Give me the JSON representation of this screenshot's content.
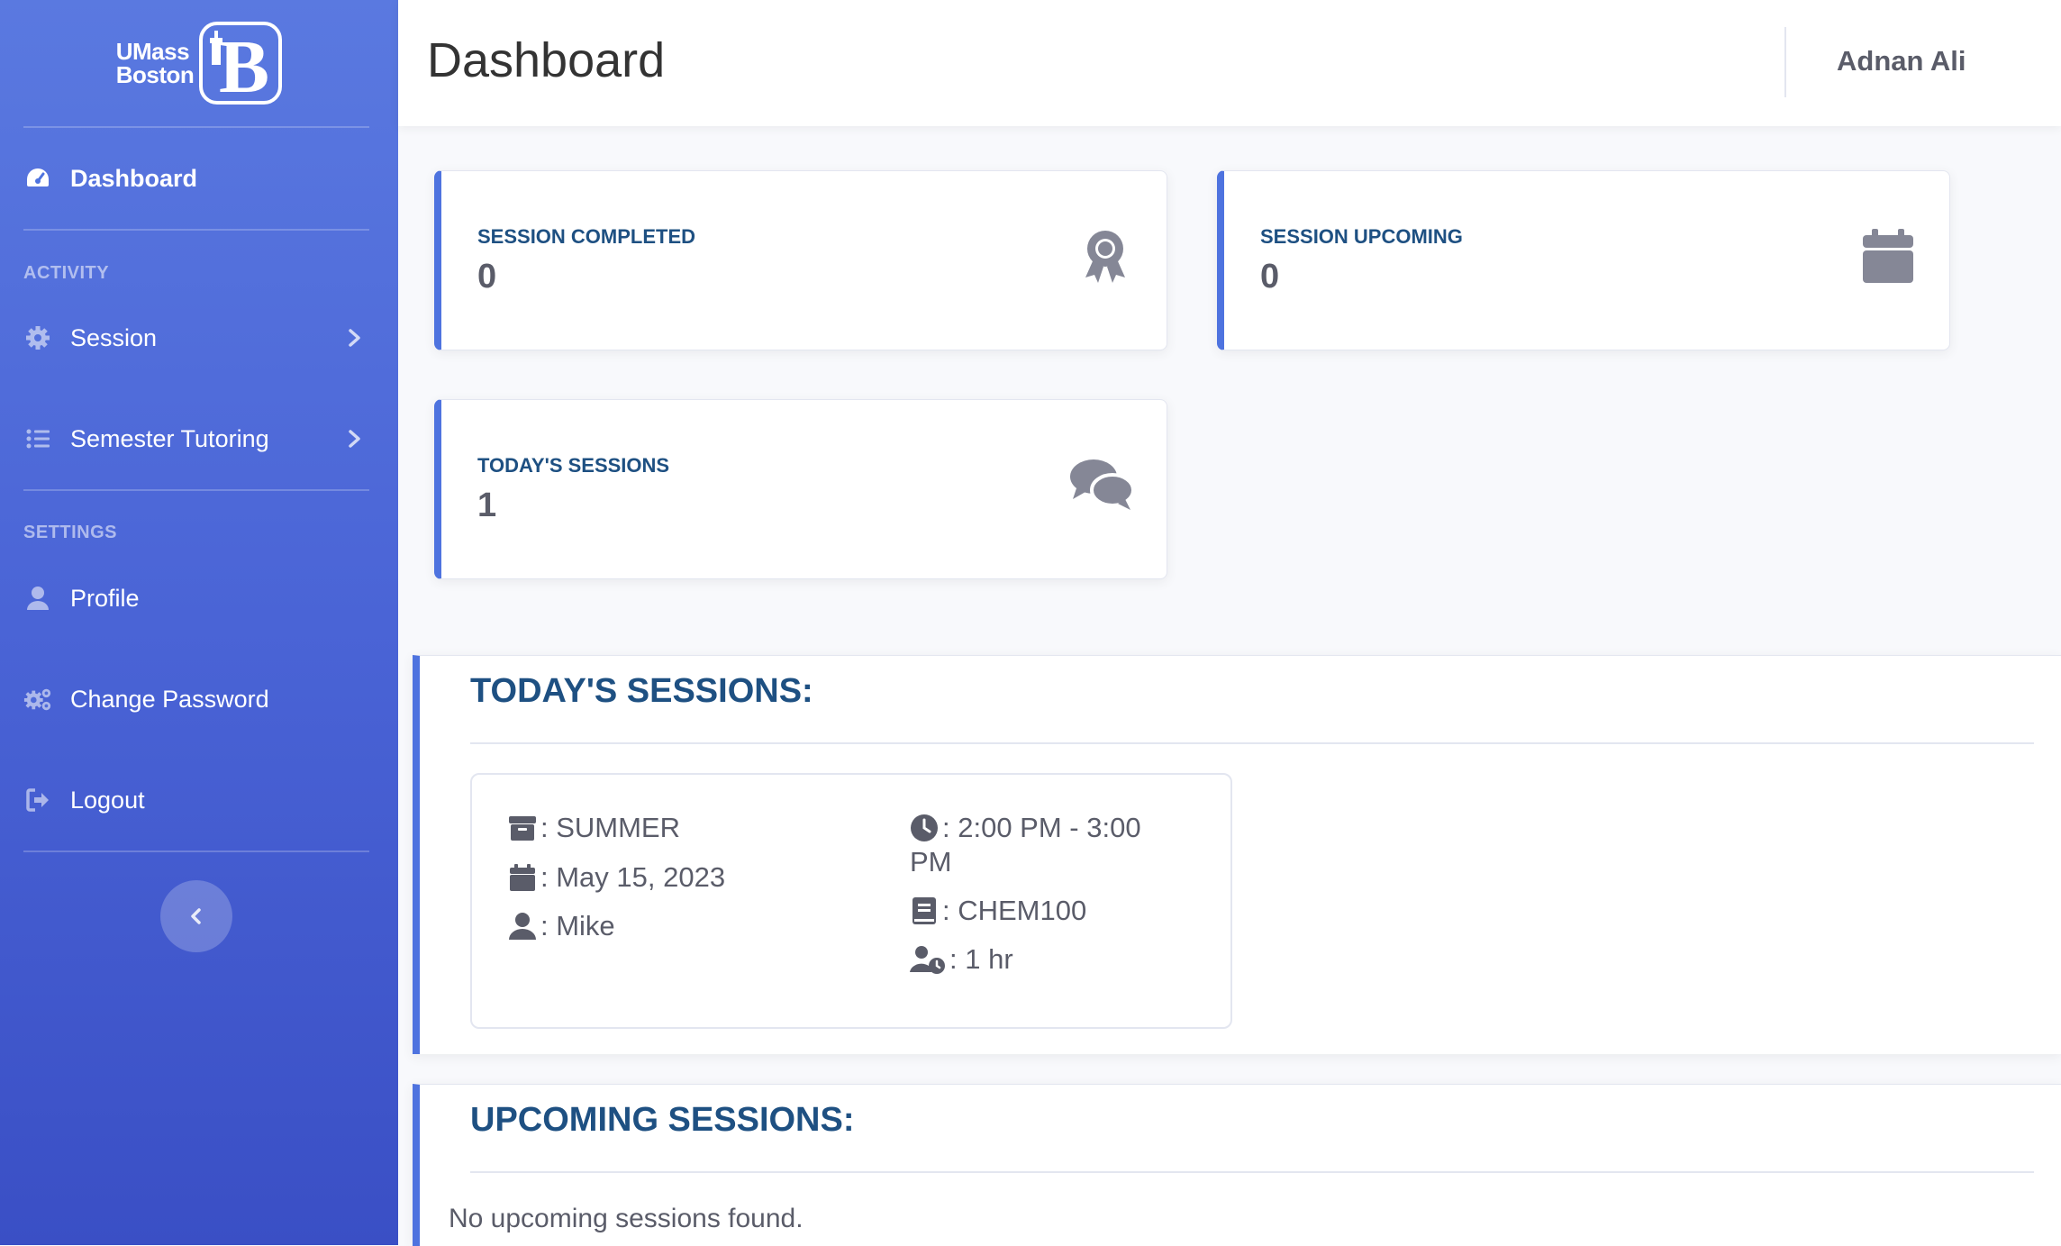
{
  "brand": {
    "line1": "UMass",
    "line2": "Boston"
  },
  "sidebar": {
    "dashboard": "Dashboard",
    "heading_activity": "ACTIVITY",
    "session": "Session",
    "semester_tutoring": "Semester Tutoring",
    "heading_settings": "SETTINGS",
    "profile": "Profile",
    "change_password": "Change Password",
    "logout": "Logout"
  },
  "topbar": {
    "title": "Dashboard",
    "user": "Adnan Ali"
  },
  "stats": [
    {
      "label": "SESSION COMPLETED",
      "value": "0",
      "icon": "award-icon"
    },
    {
      "label": "SESSION UPCOMING",
      "value": "0",
      "icon": "calendar-icon"
    },
    {
      "label": "TODAY'S SESSIONS",
      "value": "1",
      "icon": "comments-icon"
    }
  ],
  "today": {
    "title": "TODAY'S SESSIONS:",
    "session": {
      "semester": ": SUMMER",
      "date": ": May 15, 2023",
      "tutor": ": Mike",
      "time_line1": ": 2:00 PM - 3:00",
      "time_line2": "PM",
      "course": ": CHEM100",
      "duration": ": 1 hr"
    }
  },
  "upcoming": {
    "title": "UPCOMING SESSIONS:",
    "empty": "No upcoming sessions found."
  },
  "colors": {
    "sidebar": "#4e73df",
    "accent": "#4e73df",
    "title_blue": "#1e5082",
    "text_gray": "#5a5c69"
  }
}
